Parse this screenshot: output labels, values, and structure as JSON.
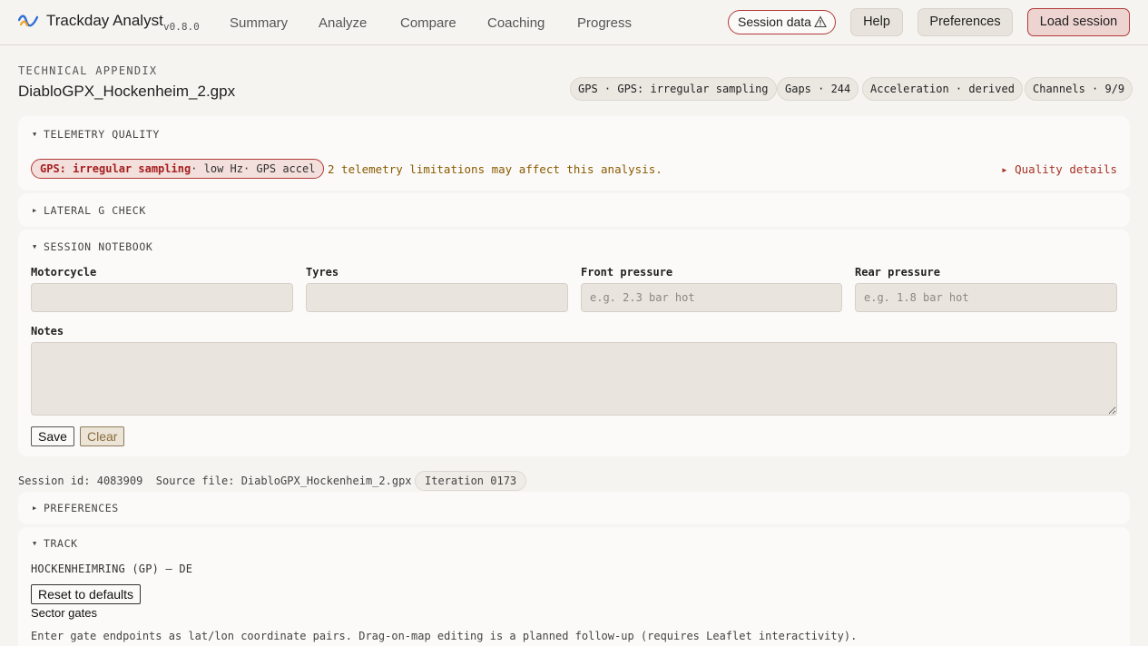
{
  "app": {
    "name": "Trackday Analyst",
    "version": "v0.8.0",
    "nav": [
      "Summary",
      "Analyze",
      "Compare",
      "Coaching",
      "Progress"
    ],
    "actions": {
      "session_data": "Session data",
      "help": "Help",
      "preferences": "Preferences",
      "load_session": "Load session"
    }
  },
  "header": {
    "kicker": "TECHNICAL APPENDIX",
    "title": "DiabloGPX_Hockenheim_2.gpx",
    "chips": [
      "GPS · GPS: irregular sampling",
      "Gaps · 244",
      "Acceleration · derived",
      "Channels · 9/9"
    ]
  },
  "quality": {
    "heading": "TELEMETRY QUALITY",
    "badge_main": "GPS: irregular sampling",
    "badge_rest": "· low Hz· GPS accel",
    "message": "2 telemetry limitations may affect this analysis.",
    "details_link": "▸ Quality details"
  },
  "lateral": {
    "heading": "LATERAL G CHECK"
  },
  "notebook": {
    "heading": "SESSION NOTEBOOK",
    "fields": {
      "motorcycle": {
        "label": "Motorcycle",
        "value": "",
        "placeholder": ""
      },
      "tyres": {
        "label": "Tyres",
        "value": "",
        "placeholder": ""
      },
      "front": {
        "label": "Front pressure",
        "value": "",
        "placeholder": "e.g. 2.3 bar hot"
      },
      "rear": {
        "label": "Rear pressure",
        "value": "",
        "placeholder": "e.g. 1.8 bar hot"
      },
      "notes": {
        "label": "Notes",
        "value": ""
      }
    },
    "save": "Save",
    "clear": "Clear"
  },
  "session": {
    "id_label": "Session id:",
    "id": "4083909",
    "source_label": "Source file:",
    "source": "DiabloGPX_Hockenheim_2.gpx",
    "iteration": "Iteration 0173"
  },
  "preferences": {
    "heading": "PREFERENCES"
  },
  "track": {
    "heading": "TRACK",
    "name": "HOCKENHEIMRING (GP) — DE",
    "reset": "Reset to defaults",
    "gates_label": "Sector gates",
    "gates_help": "Enter gate endpoints as lat/lon coordinate pairs. Drag-on-map editing is a planned follow-up (requires Leaflet interactivity)."
  },
  "colors": {
    "accent_red": "#b23a3a",
    "warning_text": "#8a5a00",
    "background": "#f6f4f0",
    "panel": "#fbfaf8"
  }
}
